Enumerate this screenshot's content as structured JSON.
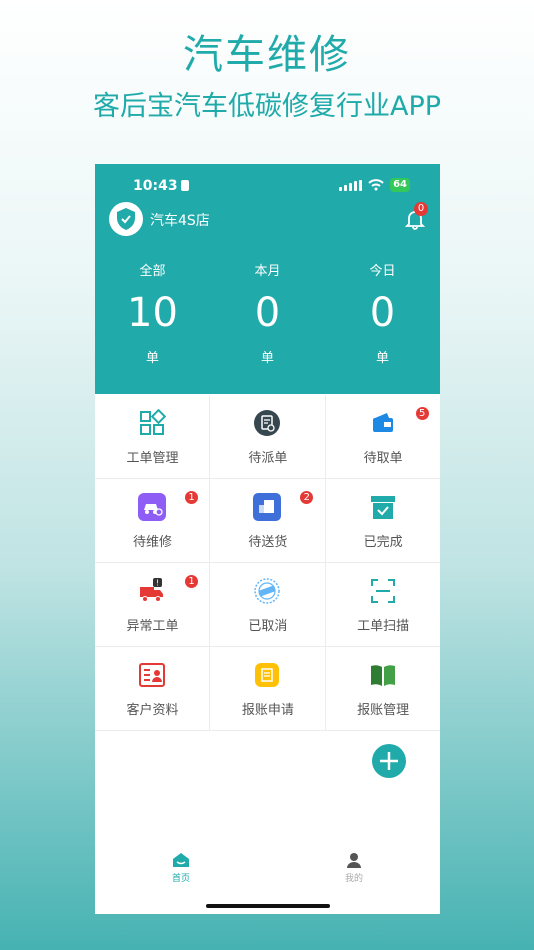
{
  "promo": {
    "title": "汽车维修",
    "subtitle": "客后宝汽车低碳修复行业APP"
  },
  "status_bar": {
    "time": "10:43",
    "battery": "64"
  },
  "header": {
    "shop_name": "汽车4S店",
    "notification_count": "0"
  },
  "stats": [
    {
      "label": "全部",
      "value": "10",
      "unit": "单"
    },
    {
      "label": "本月",
      "value": "0",
      "unit": "单"
    },
    {
      "label": "今日",
      "value": "0",
      "unit": "单"
    }
  ],
  "menu": [
    {
      "label": "工单管理",
      "icon": "grid-apps-icon",
      "badge": ""
    },
    {
      "label": "待派单",
      "icon": "dispatch-order-icon",
      "badge": ""
    },
    {
      "label": "待取单",
      "icon": "wallet-icon",
      "badge": "5"
    },
    {
      "label": "待维修",
      "icon": "car-repair-icon",
      "badge": "1"
    },
    {
      "label": "待送货",
      "icon": "delivery-icon",
      "badge": "2"
    },
    {
      "label": "已完成",
      "icon": "box-check-icon",
      "badge": ""
    },
    {
      "label": "异常工单",
      "icon": "truck-alert-icon",
      "badge": "1"
    },
    {
      "label": "已取消",
      "icon": "cancelled-stamp-icon",
      "badge": ""
    },
    {
      "label": "工单扫描",
      "icon": "scan-icon",
      "badge": ""
    },
    {
      "label": "客户资料",
      "icon": "id-card-icon",
      "badge": ""
    },
    {
      "label": "报账申请",
      "icon": "receipt-icon",
      "badge": ""
    },
    {
      "label": "报账管理",
      "icon": "book-icon",
      "badge": ""
    }
  ],
  "tabbar": {
    "home": "首页",
    "mine": "我的"
  },
  "colors": {
    "primary": "#20aaaa",
    "badge": "#e53935"
  }
}
